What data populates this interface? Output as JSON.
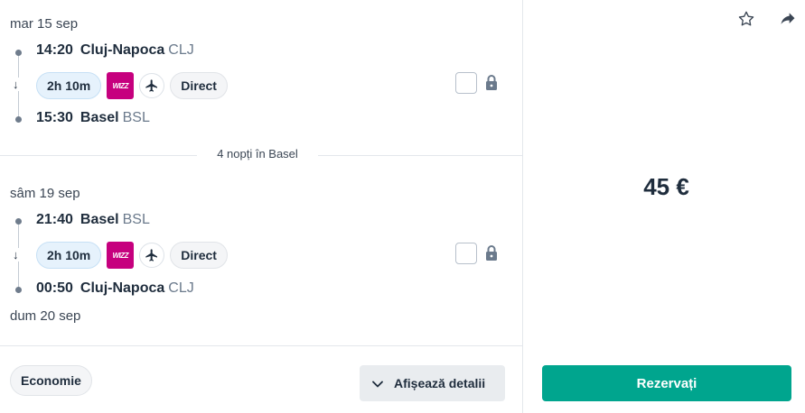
{
  "outbound": {
    "date": "mar 15 sep",
    "departure": {
      "time": "14:20",
      "city": "Cluj-Napoca",
      "code": "CLJ"
    },
    "arrival": {
      "time": "15:30",
      "city": "Basel",
      "code": "BSL"
    },
    "duration": "2h 10m",
    "airline_logo_text": "WIZZ",
    "stops_label": "Direct"
  },
  "stay": {
    "label": "4 nopți în Basel"
  },
  "inbound": {
    "date": "sâm 19 sep",
    "departure": {
      "time": "21:40",
      "city": "Basel",
      "code": "BSL"
    },
    "arrival": {
      "time": "00:50",
      "city": "Cluj-Napoca",
      "code": "CLJ"
    },
    "arrival_date": "dum 20 sep",
    "duration": "2h 10m",
    "airline_logo_text": "WIZZ",
    "stops_label": "Direct"
  },
  "footer": {
    "cabin_class": "Economie",
    "details_label": "Afișează detalii"
  },
  "price": {
    "amount": "45 €"
  },
  "booking": {
    "button_label": "Rezervați"
  },
  "colors": {
    "accent_green": "#00a58e",
    "wizz_brand": "#c6007e",
    "duration_chip_bg": "#e6f2fc"
  },
  "icons": {
    "save": "star-icon",
    "share": "share-icon",
    "plane": "plane-icon",
    "lock": "lock-icon",
    "details": "chevron-down-icon",
    "arrow": "arrow-down-icon"
  }
}
